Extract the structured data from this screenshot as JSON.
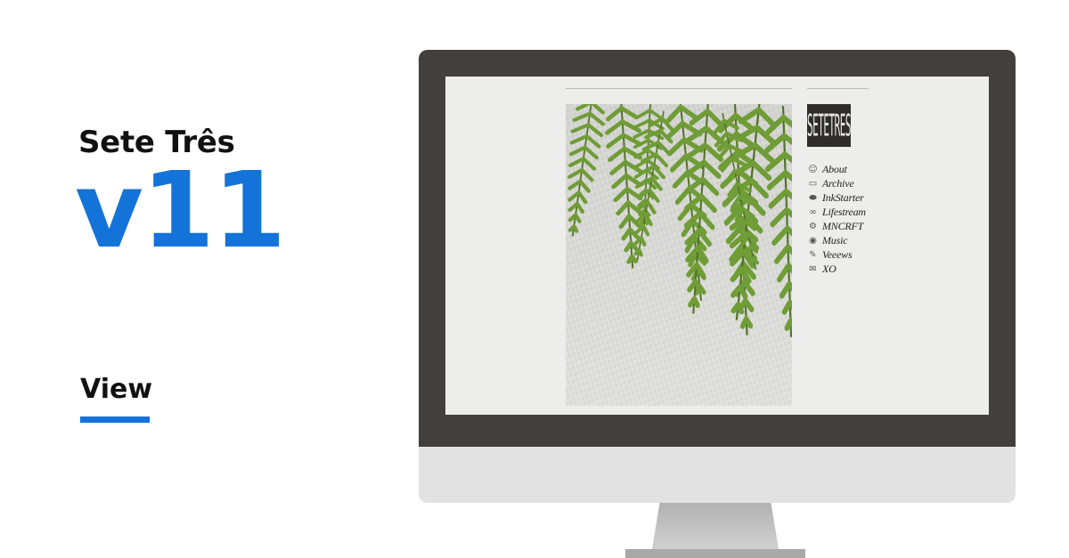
{
  "promo": {
    "site_title": "Sete Três",
    "version": "v11",
    "view_label": "View",
    "accent_color": "#1473d8"
  },
  "screen": {
    "logo_text": "SETETRES",
    "nav_items": [
      {
        "label": "About",
        "icon": "face-icon",
        "glyph": "☺"
      },
      {
        "label": "Archive",
        "icon": "folder-icon",
        "glyph": "▭"
      },
      {
        "label": "InkStarter",
        "icon": "inkwell-icon",
        "glyph": "⬬"
      },
      {
        "label": "Lifestream",
        "icon": "stream-icon",
        "glyph": "∞"
      },
      {
        "label": "MNCRFT",
        "icon": "craft-icon",
        "glyph": "⚙"
      },
      {
        "label": "Music",
        "icon": "disc-icon",
        "glyph": "◉"
      },
      {
        "label": "Veeews",
        "icon": "notepad-icon",
        "glyph": "✎"
      },
      {
        "label": "XO",
        "icon": "envelope-icon",
        "glyph": "✉"
      }
    ]
  }
}
